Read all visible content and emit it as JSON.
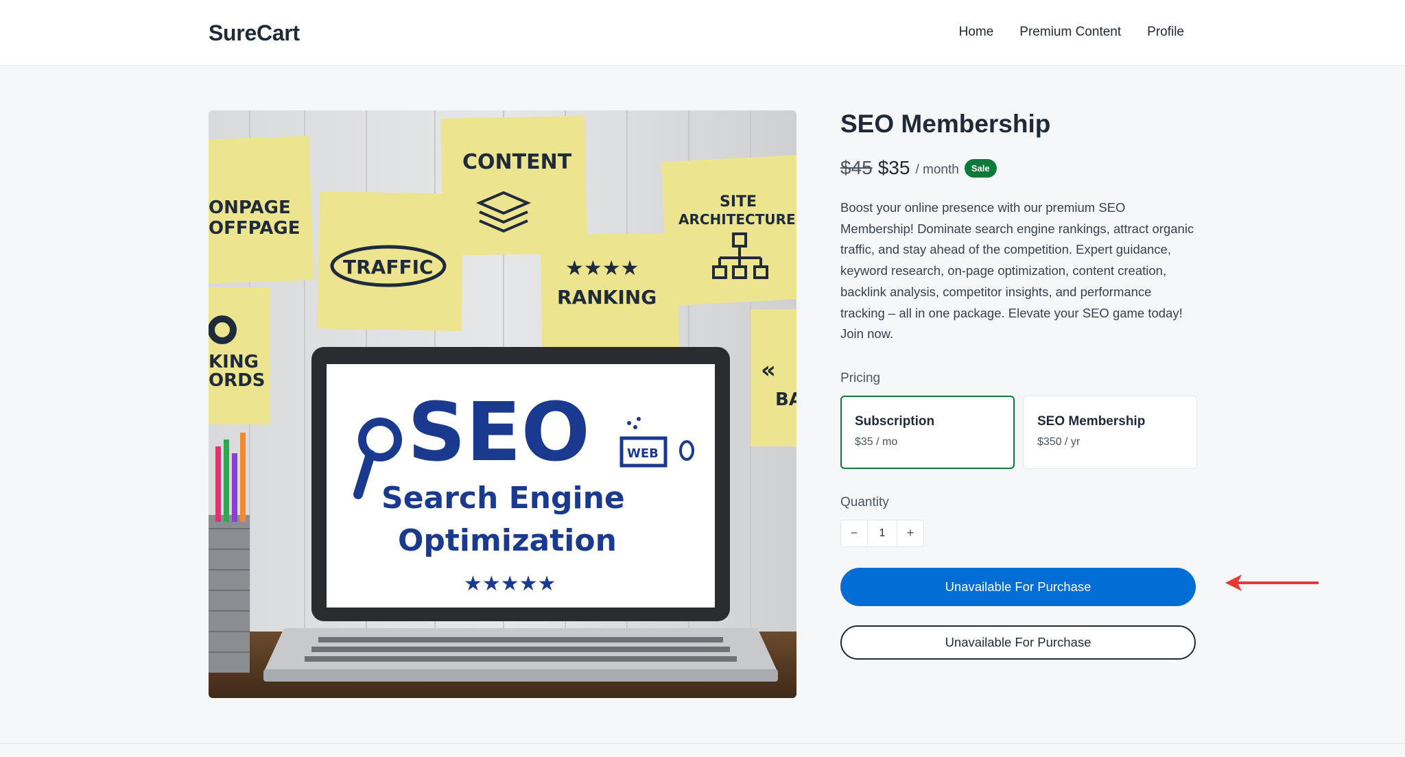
{
  "header": {
    "brand": "SureCart",
    "nav": [
      "Home",
      "Premium Content",
      "Profile"
    ]
  },
  "hero": {
    "notes": [
      "CONTENT",
      "ONPAGE",
      "OFFPAGE",
      "TRAFFIC",
      "RANKING",
      "SITE",
      "ARCHITECTURE",
      "KING",
      "ORDS",
      "BA"
    ],
    "screen_title": "SEO",
    "screen_subtitle_1": "Search Engine",
    "screen_subtitle_2": "Optimization",
    "web_label": "WEB"
  },
  "product": {
    "title": "SEO Membership",
    "old_price": "$45",
    "price": "$35",
    "period": "/ month",
    "badge": "Sale",
    "description": "Boost your online presence with our premium SEO Membership! Dominate search engine rankings, attract organic traffic, and stay ahead of the competition. Expert guidance, keyword research, on-page optimization, content creation, backlink analysis, competitor insights, and performance tracking – all in one package. Elevate your SEO game today! Join now."
  },
  "pricing": {
    "label": "Pricing",
    "options": [
      {
        "name": "Subscription",
        "price": "$35 / mo",
        "selected": true
      },
      {
        "name": "SEO Membership",
        "price": "$350 / yr",
        "selected": false
      }
    ]
  },
  "quantity": {
    "label": "Quantity",
    "minus": "−",
    "value": "1",
    "plus": "+"
  },
  "buttons": {
    "primary": "Unavailable For Purchase",
    "secondary": "Unavailable For Purchase"
  },
  "colors": {
    "primary_button": "#036dd6",
    "sale_badge": "#0b7a3b",
    "selected_border": "#0b7a3b",
    "annotation_arrow": "#e53935"
  }
}
